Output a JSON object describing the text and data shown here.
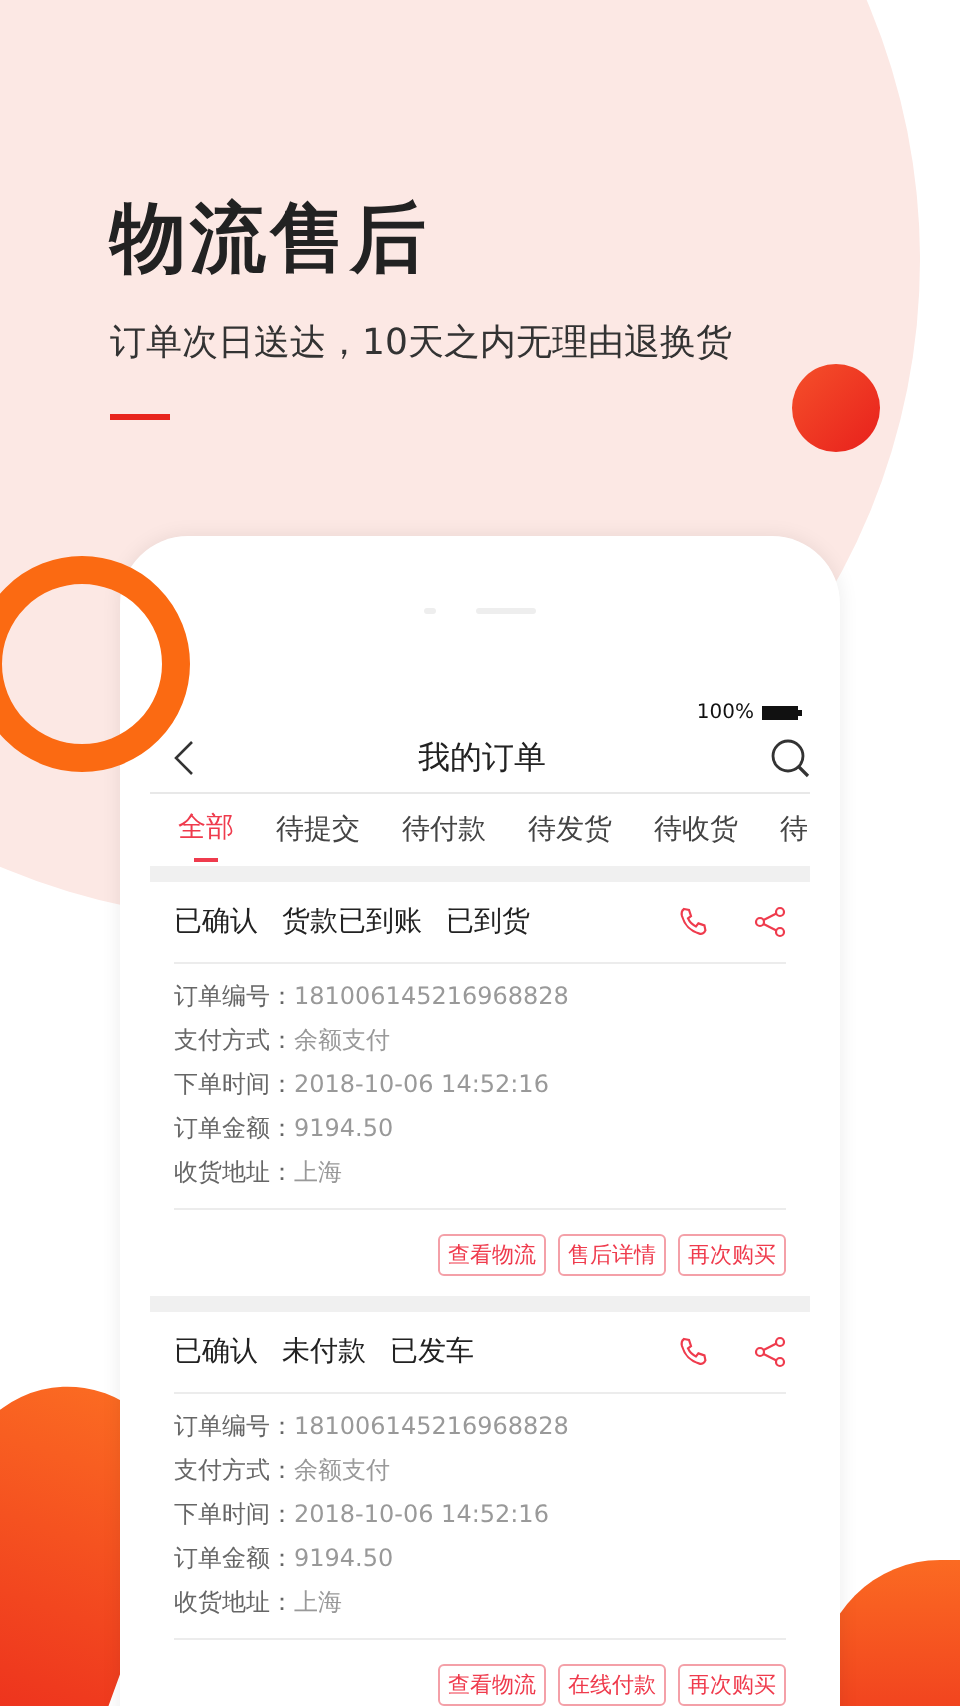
{
  "hero": {
    "title": "物流售后",
    "subtitle": "订单次日送达，10天之内无理由退换货"
  },
  "phone": {
    "status_bar": {
      "battery": "100%"
    },
    "nav": {
      "title": "我的订单"
    },
    "tabs": [
      {
        "label": "全部",
        "selected": true
      },
      {
        "label": "待提交",
        "selected": false
      },
      {
        "label": "待付款",
        "selected": false
      },
      {
        "label": "待发货",
        "selected": false
      },
      {
        "label": "待收货",
        "selected": false
      },
      {
        "label": "待",
        "selected": false
      }
    ],
    "orders": [
      {
        "statuses": [
          "已确认",
          "货款已到账",
          "已到货"
        ],
        "fields": [
          {
            "label": "订单编号：",
            "value": "181006145216968828"
          },
          {
            "label": "支付方式：",
            "value": "余额支付"
          },
          {
            "label": "下单时间：",
            "value": "2018-10-06 14:52:16"
          },
          {
            "label": "订单金额：",
            "value": "9194.50"
          },
          {
            "label": "收货地址：",
            "value": "上海"
          }
        ],
        "actions": [
          "查看物流",
          "售后详情",
          "再次购买"
        ]
      },
      {
        "statuses": [
          "已确认",
          "未付款",
          "已发车"
        ],
        "fields": [
          {
            "label": "订单编号：",
            "value": "181006145216968828"
          },
          {
            "label": "支付方式：",
            "value": "余额支付"
          },
          {
            "label": "下单时间：",
            "value": "2018-10-06 14:52:16"
          },
          {
            "label": "订单金额：",
            "value": "9194.50"
          },
          {
            "label": "收货地址：",
            "value": "上海"
          }
        ],
        "actions": [
          "查看物流",
          "在线付款",
          "再次购买"
        ]
      }
    ]
  }
}
